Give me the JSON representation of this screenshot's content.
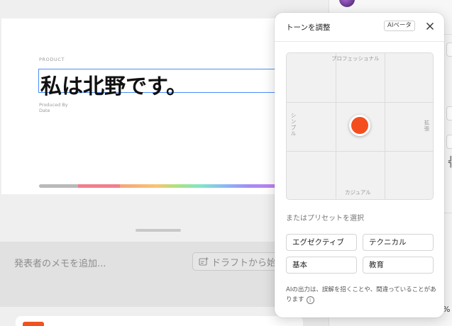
{
  "slide": {
    "kicker": "PRODUCT",
    "title": "私は北野です。",
    "produced_by": "Produced By",
    "date": "Date"
  },
  "notes": {
    "placeholder": "発表者のメモを追加...",
    "draft_button": "ドラフトから始"
  },
  "sidebar": {
    "zoom_fragment": "%"
  },
  "tone_panel": {
    "title": "トーンを調整",
    "badge": "AIベータ",
    "close_icon": "close-icon",
    "grid_labels": {
      "top": "プロフェッショナル",
      "bottom": "カジュアル",
      "left": "シンプル",
      "right": "拡張"
    },
    "selector": {
      "column": 2,
      "row": 2,
      "columns": 3,
      "rows": 3,
      "color": "#f44e1f"
    },
    "preset_heading": "またはプリセットを選択",
    "presets": [
      "エグゼクティブ",
      "テクニカル",
      "基本",
      "教育"
    ],
    "disclaimer": "AIの出力は、誤解を招くことや、間違っていることがあります",
    "info_icon": "i"
  },
  "colors": {
    "accent": "#f44e1f",
    "selection_border": "#4a8df8"
  }
}
